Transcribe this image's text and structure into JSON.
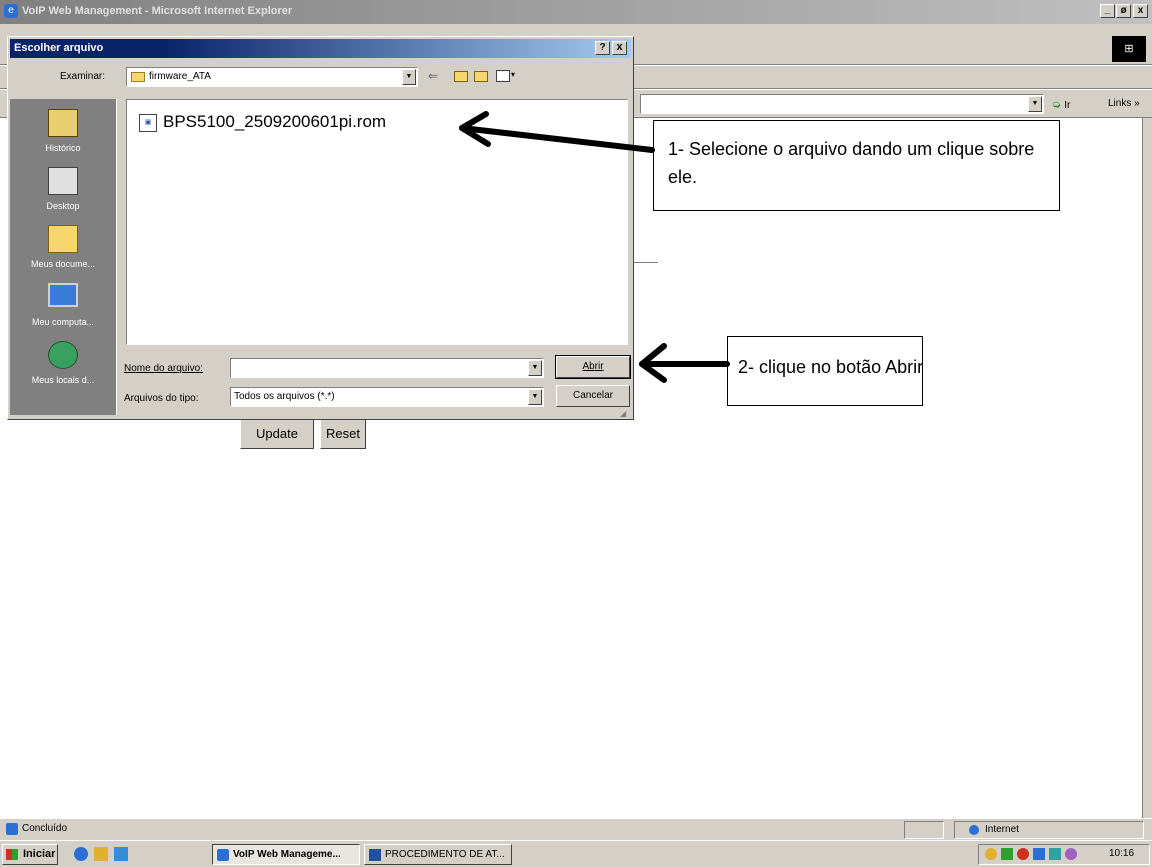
{
  "browser": {
    "title": "VoIP Web Management - Microsoft Internet Explorer",
    "window_controls": [
      "_",
      "ø",
      "x"
    ],
    "links_label": "Links »",
    "go_label": "Ir"
  },
  "page": {
    "update_label": "Update",
    "reset_label": "Reset"
  },
  "dialog": {
    "title": "Escolher arquivo",
    "help_label": "?",
    "close_label": "x",
    "look_in_label": "Examinar:",
    "folder": "firmware_ATA",
    "places": [
      "Histórico",
      "Desktop",
      "Meus docume...",
      "Meu computa...",
      "Meus locais d..."
    ],
    "files": [
      "BPS5100_2509200601pi.rom"
    ],
    "filename_label": "Nome do arquivo:",
    "filename_value": "",
    "filetype_label": "Arquivos do tipo:",
    "filetype_value": "Todos os arquivos (*.*)",
    "open_label": "Abrir",
    "cancel_label": "Cancelar"
  },
  "callouts": {
    "step1": "1- Selecione o arquivo dando um clique sobre ele.",
    "step2": "2- clique no botão Abrir"
  },
  "status_bar": {
    "text": "Concluído",
    "zone": "Internet"
  },
  "taskbar": {
    "start_label": "Iniciar",
    "tasks": [
      "VoIP Web Manageme...",
      "PROCEDIMENTO DE AT..."
    ],
    "clock": "10:16"
  },
  "colors": {
    "titlebar_active": "#0a246a",
    "titlebar_gradient_end": "#a6caf0",
    "titlebar_inactive": "#808080",
    "places_bar": "#808080",
    "face": "#d4d0c8"
  }
}
